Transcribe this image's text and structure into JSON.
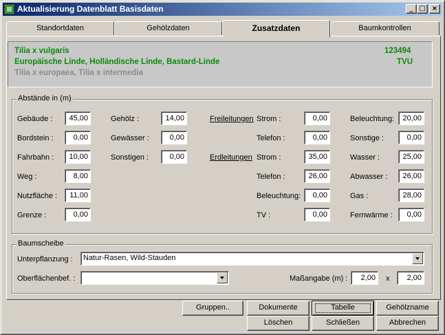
{
  "window": {
    "title": "Aktualisierung Datenblatt  Basisdaten",
    "controls": {
      "minimize": "_",
      "maximize": "□",
      "close": "×"
    }
  },
  "tabs": [
    {
      "label": "Standortdaten",
      "active": false
    },
    {
      "label": "Gehölzdaten",
      "active": false
    },
    {
      "label": "Zusatzdaten",
      "active": true
    },
    {
      "label": "Baumkontrollen",
      "active": false
    }
  ],
  "info": {
    "botanical_name": "Tilia x vulgaris",
    "id": "123494",
    "common_names": "Europäische Linde, Holländische Linde, Bastard-Linde",
    "code": "TVU",
    "synonyms": "Tilia x europaea, Tilia x intermedia"
  },
  "abstaende": {
    "legend": "Abstände in (m)",
    "col1": [
      {
        "label": "Gebäude :",
        "value": "45,00"
      },
      {
        "label": "Bordstein :",
        "value": "0,00"
      },
      {
        "label": "Fahrbahn :",
        "value": "10,00"
      },
      {
        "label": "Weg :",
        "value": "8,00"
      },
      {
        "label": "Nutzfläche :",
        "value": "11,00"
      },
      {
        "label": "Grenze :",
        "value": "0,00"
      }
    ],
    "col2": [
      {
        "label": "Gehölz :",
        "value": "14,00"
      },
      {
        "label": "Gewässer :",
        "value": "0,00"
      },
      {
        "label": "Sonstigen :",
        "value": "0,00"
      }
    ],
    "freileitungen_label": "Freileitungen",
    "erdleitungen_label": "Erdleitungen",
    "col3": [
      {
        "label": "Strom :",
        "value": "0,00"
      },
      {
        "label": "Telefon :",
        "value": "0,00"
      },
      {
        "label": "Strom :",
        "value": "35,00"
      },
      {
        "label": "Telefon :",
        "value": "26,00"
      },
      {
        "label": "Beleuchtung:",
        "value": "0,00"
      },
      {
        "label": "TV :",
        "value": "0,00"
      }
    ],
    "col4": [
      {
        "label": "Beleuchtung:",
        "value": "20,00"
      },
      {
        "label": "Sonstige :",
        "value": "0,00"
      },
      {
        "label": "Wasser :",
        "value": "25,00"
      },
      {
        "label": "Abwasser :",
        "value": "26,00"
      },
      {
        "label": "Gas :",
        "value": "28,00"
      },
      {
        "label": "Fernwärme :",
        "value": "0,00"
      }
    ]
  },
  "baumscheibe": {
    "legend": "Baumscheibe",
    "unterpflanzung_label": "Unterpflanzung :",
    "unterpflanzung_value": "Natur-Rasen, Wild-Stauden",
    "oberflaeche_label": "Oberflächenbef. :",
    "oberflaeche_value": "",
    "massangabe_label": "Maßangabe (m) :",
    "mass_x": "2,00",
    "times": "x",
    "mass_y": "2,00"
  },
  "buttons": {
    "gruppen": "Gruppen..",
    "dokumente": "Dokumente",
    "tabelle": "Tabelle",
    "gehoelzname": "Gehölzname",
    "loeschen": "Löschen",
    "schliessen": "Schließen",
    "abbrechen": "Abbrechen"
  }
}
